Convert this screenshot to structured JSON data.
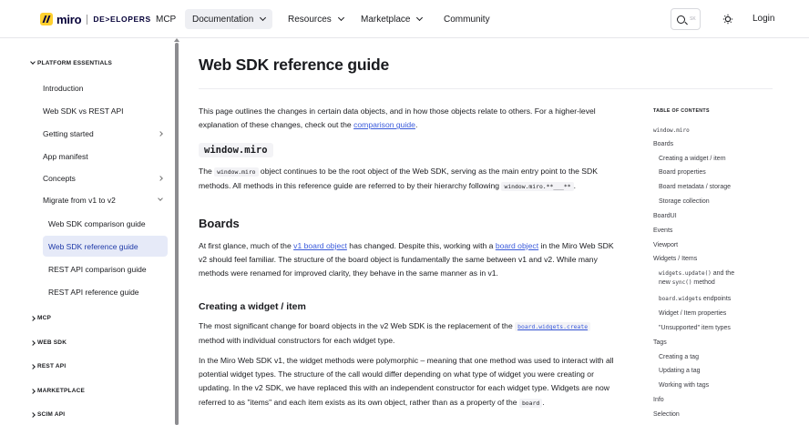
{
  "nav": {
    "logo_word": "miro",
    "logo_suffix": "DE>ELOPERS",
    "items": [
      "MCP",
      "Documentation",
      "Resources",
      "Marketplace",
      "Community"
    ],
    "search_placeholder": "SK",
    "login": "Login"
  },
  "sidebar": {
    "section_platform": "PLATFORM ESSENTIALS",
    "items": [
      "Introduction",
      "Web SDK vs REST API",
      "Getting started",
      "App manifest",
      "Concepts",
      "Migrate from v1 to v2"
    ],
    "subitems": [
      "Web SDK comparison guide",
      "Web SDK reference guide",
      "REST API comparison guide",
      "REST API reference guide"
    ],
    "sections": [
      "MCP",
      "WEB SDK",
      "REST API",
      "MARKETPLACE",
      "SCIM API"
    ]
  },
  "main": {
    "title": "Web SDK reference guide",
    "intro_1": "This page outlines the changes in certain data objects, and in how those objects relate to others. For a higher-level explanation of these changes, check out the ",
    "intro_link": "comparison guide",
    "intro_2": ".",
    "window_miro_heading": "window.miro",
    "wm_1": "The ",
    "wm_code": "window.miro",
    "wm_2": " object continues to be the root object of the Web SDK, serving as the main entry point to the SDK methods. All methods in this reference guide are referred to by their hierarchy following ",
    "wm_code2": "window.miro.**___**",
    "wm_3": ".",
    "boards_heading": "Boards",
    "b_1": "At first glance, much of the ",
    "b_link1": "v1 board object",
    "b_2": " has changed. Despite this, working with a ",
    "b_link2": "board object",
    "b_3": " in the Miro Web SDK v2 should feel familiar. The structure of the board object is fundamentally the same between v1 and v2. While many methods were renamed for improved clarity, they behave in the same manner as in v1.",
    "cw_heading": "Creating a widget / item",
    "cw_1": "The most significant change for board objects in the v2 Web SDK is the replacement of the ",
    "cw_code": "board.widgets.create",
    "cw_2": " method with individual constructors for each widget type.",
    "poly": "In the Miro Web SDK v1, the widget methods were polymorphic – meaning that one method was used to interact with all potential widget types. The structure of the call would differ depending on what type of widget you were creating or updating. In the v2 SDK, we have replaced this with an independent constructor for each widget type. Widgets are now referred to as \"items\" and each item exists as its own object, rather than as a property of the ",
    "poly_code": "board",
    "poly_end": "."
  },
  "toc": {
    "title": "TABLE OF CONTENTS",
    "items": [
      {
        "label": "window.miro",
        "level": 0,
        "code": true
      },
      {
        "label": "Boards",
        "level": 0
      },
      {
        "label": "Creating a widget / item",
        "level": 1
      },
      {
        "label": "Board properties",
        "level": 1
      },
      {
        "label": "Board metadata / storage",
        "level": 1
      },
      {
        "label": "Storage collection",
        "level": 1
      },
      {
        "label": "BoardUI",
        "level": 0
      },
      {
        "label": "Events",
        "level": 0
      },
      {
        "label": "Viewport",
        "level": 0
      },
      {
        "label": "Widgets / Items",
        "level": 0
      },
      {
        "label_code1": "widgets.update()",
        "label_mid": " and the",
        "label_line2_pre": "new ",
        "label_code2": "sync()",
        "label_line2_post": " method",
        "level": 1
      },
      {
        "label_code1": "board.widgets",
        "label_mid": " endpoints",
        "level": 1
      },
      {
        "label": "Widget / Item properties",
        "level": 1
      },
      {
        "label": "\"Unsupported\" item types",
        "level": 1
      },
      {
        "label": "Tags",
        "level": 0
      },
      {
        "label": "Creating a tag",
        "level": 1
      },
      {
        "label": "Updating a tag",
        "level": 1
      },
      {
        "label": "Working with tags",
        "level": 1
      },
      {
        "label": "Info",
        "level": 0
      },
      {
        "label": "Selection",
        "level": 0
      }
    ]
  },
  "colors": {
    "accent": "#3b5bdb",
    "logo": "#ffd02f",
    "active_bg": "#e6eaf8"
  }
}
